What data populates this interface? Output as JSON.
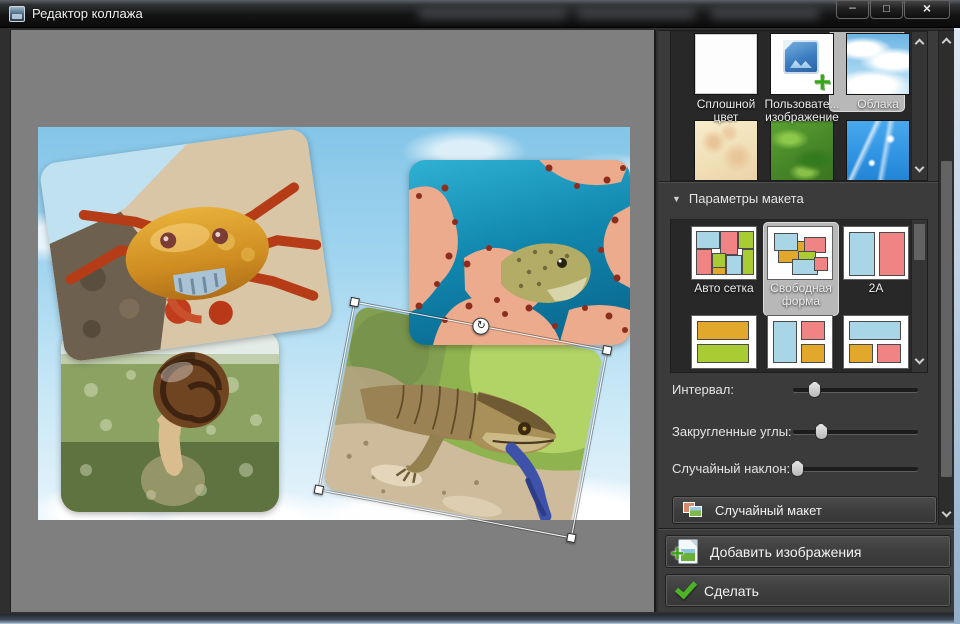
{
  "window": {
    "title": "Редактор коллажа",
    "controls": {
      "minimize": "–",
      "maximize": "□",
      "close": "×"
    }
  },
  "icons": {
    "rotate": "↻",
    "collapse_arrow": "▼",
    "custom_image_plus": "+",
    "add_images_plus": "+"
  },
  "canvas": {
    "background_name": "Облака",
    "photos": [
      {
        "name": "crab"
      },
      {
        "name": "moray-eel"
      },
      {
        "name": "snail"
      },
      {
        "name": "lizard",
        "selected": true
      }
    ]
  },
  "backgrounds": {
    "items": [
      {
        "label": "Сплошной цвет",
        "selected": false
      },
      {
        "label": "Пользовате... изображение",
        "selected": false
      },
      {
        "label": "Облака",
        "selected": true
      },
      {
        "label": "",
        "selected": false
      },
      {
        "label": "",
        "selected": false
      },
      {
        "label": "",
        "selected": false
      }
    ]
  },
  "layout_section": {
    "header": "Параметры макета",
    "items": [
      {
        "label": "Авто сетка",
        "selected": false
      },
      {
        "label": "Свободная форма",
        "selected": true
      },
      {
        "label": "2A",
        "selected": false
      },
      {
        "label": ""
      },
      {
        "label": ""
      },
      {
        "label": ""
      }
    ],
    "sliders": [
      {
        "label": "Интервал:",
        "value_pct": 17
      },
      {
        "label": "Закругленные углы:",
        "value_pct": 22
      },
      {
        "label": "Случайный наклон:",
        "value_pct": 3
      }
    ],
    "random_layout_label": "Случайный макет"
  },
  "actions": {
    "add_images_label": "Добавить изображения",
    "make_label": "Сделать"
  }
}
